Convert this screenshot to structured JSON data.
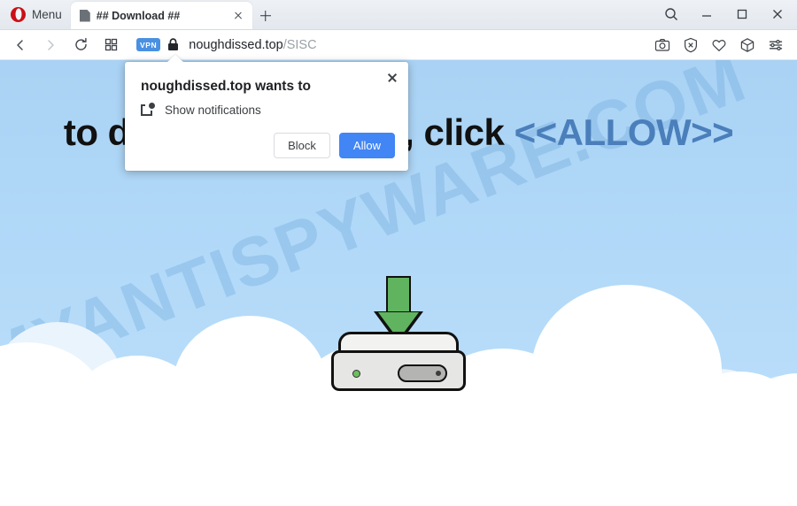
{
  "browser": {
    "menu_label": "Menu",
    "tab": {
      "title": "## Download ##",
      "favicon_name": "document-icon",
      "close_name": "tab-close-icon"
    },
    "new_tab_label": "+",
    "window_controls": {
      "search": "search-icon",
      "minimize": "minimize-icon",
      "maximize": "maximize-icon",
      "close": "window-close-icon"
    },
    "nav": {
      "back": "back-arrow-icon",
      "forward": "forward-arrow-icon",
      "reload": "reload-icon",
      "tiles": "tab-grid-icon",
      "vpn_badge": "VPN",
      "lock": "padlock-icon",
      "url_host": "noughdissed.top",
      "url_path": "/SISC",
      "url_full": "noughdissed.top/SISC"
    },
    "nav_right_icons": [
      "snapshot-camera-icon",
      "ad-blocker-shield-icon",
      "heart-icon",
      "crypto-wallet-cube-icon",
      "easy-setup-sliders-icon"
    ]
  },
  "dialog": {
    "title": "noughdissed.top wants to",
    "permission_icon": "show-notifications-icon",
    "permission_label": "Show notifications",
    "block_label": "Block",
    "allow_label": "Allow",
    "close_label": "×",
    "allow_color": "#4285f4"
  },
  "page": {
    "headline_prefix": "to download the file, click ",
    "headline_allow": "<<ALLOW>>",
    "headline_allow_color": "#4a7fbb",
    "watermark": "MYANTISPYWARE.COM",
    "illustration_name": "hard-drive-download-icon",
    "sky_color": "#b2d9f8",
    "cloud_color": "#ffffff",
    "arrow_color": "#60b460"
  }
}
